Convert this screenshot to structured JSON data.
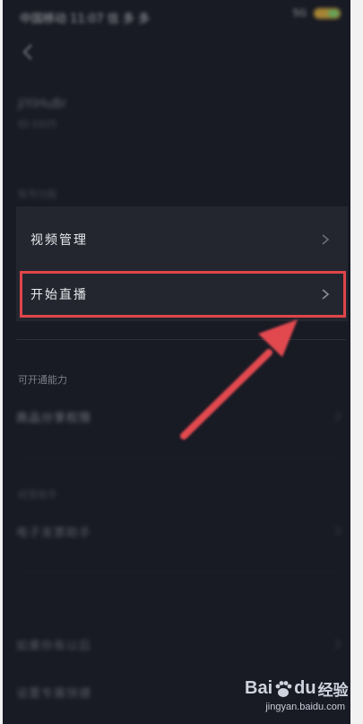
{
  "status_bar": {
    "left_text": "中国移动 11:07 信 多 多",
    "right_text": "5G"
  },
  "account": {
    "title": "jiYiHuBr",
    "subtitle": "ID:1025"
  },
  "section1": {
    "label": "账号功能",
    "items": [
      {
        "label": "视频管理"
      },
      {
        "label": "开始直播"
      }
    ]
  },
  "section2": {
    "label": "可开通能力",
    "items": [
      {
        "label": "商品分享权限"
      }
    ]
  },
  "section3": {
    "label": "经营助手",
    "items": [
      {
        "label": "电子发票助手"
      }
    ]
  },
  "section4": {
    "label": "",
    "items": [
      {
        "label": "如果你有以后"
      },
      {
        "label": "设置专属快捷"
      }
    ]
  },
  "watermark": {
    "brand": "Bai",
    "brand_suffix": "du",
    "brand_cn": "经验",
    "url": "jingyan.baidu.com"
  },
  "colors": {
    "background": "#181a24",
    "highlight": "#e0454a",
    "row_bg": "#24262f"
  },
  "icons": {
    "back": "chevron-left-icon",
    "row": "chevron-right-icon",
    "arrow": "annotation-arrow"
  }
}
